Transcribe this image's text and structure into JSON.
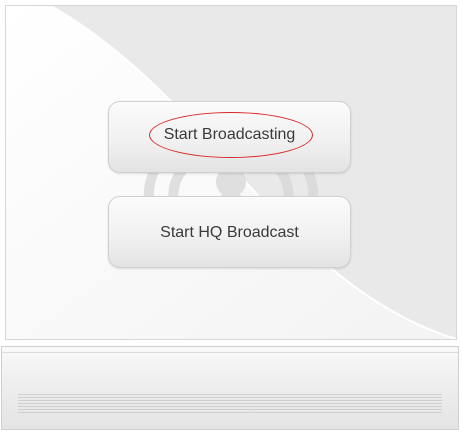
{
  "buttons": {
    "start_broadcasting": "Start Broadcasting",
    "start_hq_broadcast": "Start HQ Broadcast"
  },
  "icons": {
    "watermark": "broadcast-tower-icon"
  },
  "colors": {
    "highlight_oval": "#d8282c",
    "button_text": "#3a3a3a",
    "panel_background": "#ececec"
  }
}
